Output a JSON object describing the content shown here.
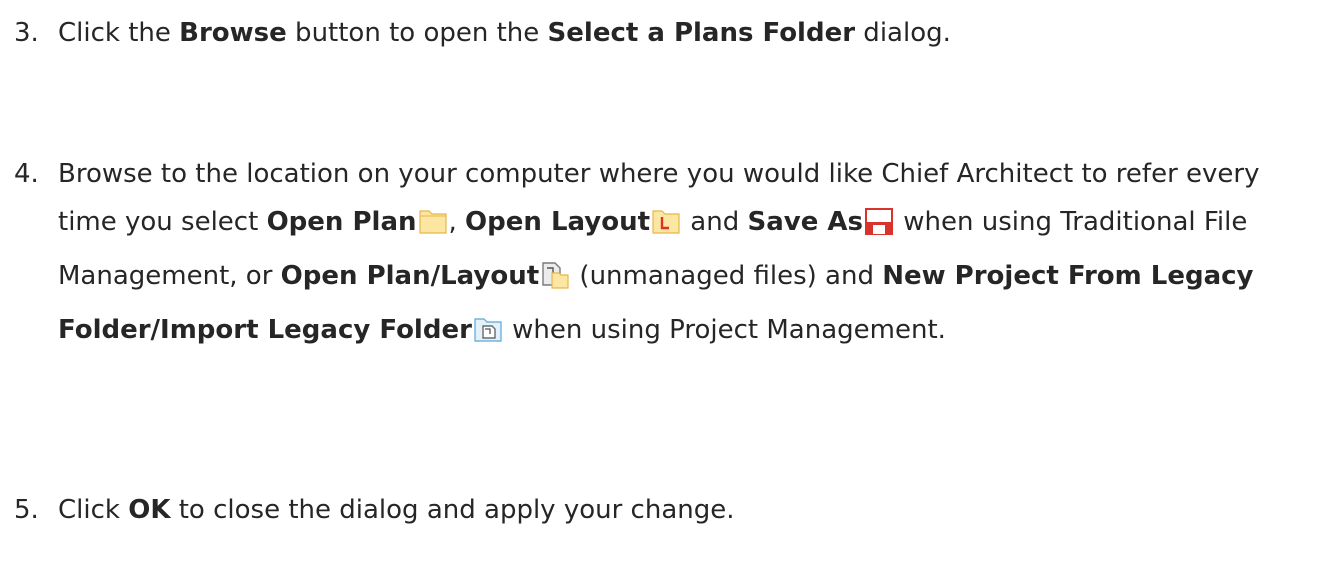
{
  "steps": [
    {
      "number": "3.",
      "t1": "Click the ",
      "b1": "Browse",
      "t2": " button to open the ",
      "b2": "Select a Plans Folder",
      "t3": " dialog."
    },
    {
      "number": "4.",
      "t1": "Browse to the location on your computer where you would like Chief Architect to refer every time you select ",
      "b1": "Open Plan",
      "t2": ", ",
      "b2": "Open Layout",
      "t3": " and ",
      "b3": "Save As",
      "t4": " when using Traditional File Management, or ",
      "b4": "Open Plan/Layout",
      "t5": " (unmanaged files) and ",
      "b5": "New Project From Legacy Folder/Import Legacy Folder",
      "t6": " when using Project Management."
    },
    {
      "number": "5.",
      "t1": "Click ",
      "b1": "OK",
      "t2": " to close the dialog and apply your change."
    }
  ],
  "icons": {
    "open_plan": "folder-icon",
    "open_layout": "layout-folder-icon",
    "save_as": "save-disk-icon",
    "open_plan_layout": "plan-layout-icon",
    "legacy_folder": "legacy-folder-icon"
  }
}
